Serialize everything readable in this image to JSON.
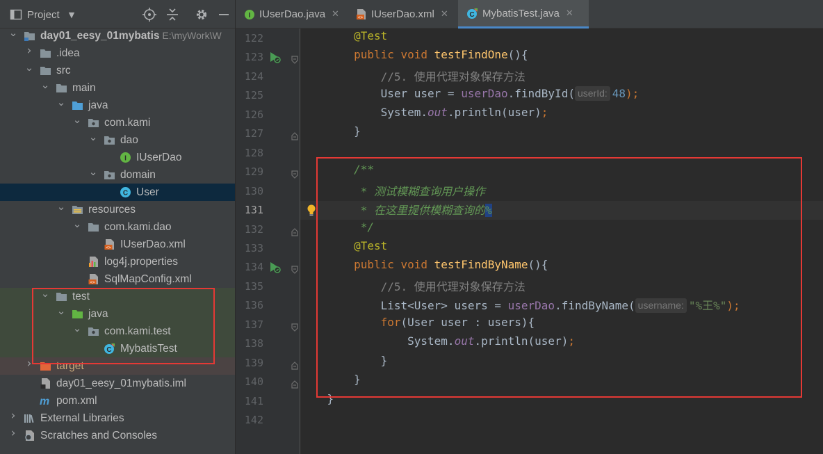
{
  "project_panel": {
    "title": "Project",
    "tree": [
      {
        "label": "day01_eesy_01mybatis",
        "path": "E:\\myWork\\W",
        "icon": "module-folder-icon",
        "depth": 0,
        "arrow": "down"
      },
      {
        "label": ".idea",
        "icon": "folder-icon",
        "depth": 1,
        "arrow": "right"
      },
      {
        "label": "src",
        "icon": "folder-icon",
        "depth": 1,
        "arrow": "down"
      },
      {
        "label": "main",
        "icon": "folder-icon",
        "depth": 2,
        "arrow": "down"
      },
      {
        "label": "java",
        "icon": "source-folder-icon",
        "depth": 3,
        "arrow": "down"
      },
      {
        "label": "com.kami",
        "icon": "package-icon",
        "depth": 4,
        "arrow": "down"
      },
      {
        "label": "dao",
        "icon": "package-icon",
        "depth": 5,
        "arrow": "down"
      },
      {
        "label": "IUserDao",
        "icon": "interface-icon",
        "depth": 6,
        "arrow": "none"
      },
      {
        "label": "domain",
        "icon": "package-icon",
        "depth": 5,
        "arrow": "down"
      },
      {
        "label": "User",
        "icon": "class-icon",
        "depth": 6,
        "arrow": "none",
        "selected": true
      },
      {
        "label": "resources",
        "icon": "resources-folder-icon",
        "depth": 3,
        "arrow": "down"
      },
      {
        "label": "com.kami.dao",
        "icon": "folder-icon",
        "depth": 4,
        "arrow": "down"
      },
      {
        "label": "IUserDao.xml",
        "icon": "xml-file-icon",
        "depth": 5,
        "arrow": "none"
      },
      {
        "label": "log4j.properties",
        "icon": "properties-file-icon",
        "depth": 4,
        "arrow": "none"
      },
      {
        "label": "SqlMapConfig.xml",
        "icon": "xml-file-icon",
        "depth": 4,
        "arrow": "none"
      },
      {
        "label": "test",
        "icon": "folder-icon",
        "depth": 2,
        "arrow": "down",
        "zone": "test"
      },
      {
        "label": "java",
        "icon": "test-source-folder-icon",
        "depth": 3,
        "arrow": "down",
        "zone": "test"
      },
      {
        "label": "com.kami.test",
        "icon": "package-icon",
        "depth": 4,
        "arrow": "down",
        "zone": "test"
      },
      {
        "label": "MybatisTest",
        "icon": "test-class-icon",
        "depth": 5,
        "arrow": "none",
        "zone": "test"
      },
      {
        "label": "target",
        "icon": "excluded-folder-icon",
        "depth": 1,
        "arrow": "right",
        "zone": "excluded"
      },
      {
        "label": "day01_eesy_01mybatis.iml",
        "icon": "iml-file-icon",
        "depth": 1,
        "arrow": "none"
      },
      {
        "label": "pom.xml",
        "icon": "maven-icon",
        "depth": 1,
        "arrow": "none"
      },
      {
        "label": "External Libraries",
        "icon": "libraries-icon",
        "depth": 0,
        "arrow": "right"
      },
      {
        "label": "Scratches and Consoles",
        "icon": "scratches-icon",
        "depth": 0,
        "arrow": "right"
      }
    ]
  },
  "tabs": [
    {
      "label": "IUserDao.java",
      "icon": "interface-icon",
      "active": false
    },
    {
      "label": "IUserDao.xml",
      "icon": "xml-file-icon",
      "active": false
    },
    {
      "label": "MybatisTest.java",
      "icon": "test-class-icon",
      "active": true
    }
  ],
  "editor": {
    "current_line": 131,
    "lines": [
      {
        "n": 122,
        "tokens": [
          [
            "    ",
            ""
          ],
          [
            "@Test",
            "ann"
          ]
        ]
      },
      {
        "n": 123,
        "run": true,
        "fold": "start",
        "tokens": [
          [
            "    ",
            ""
          ],
          [
            "public",
            "kw"
          ],
          [
            " ",
            ""
          ],
          [
            "void",
            "kw"
          ],
          [
            " ",
            ""
          ],
          [
            "testFindOne",
            "fn"
          ],
          [
            "(){",
            ""
          ]
        ]
      },
      {
        "n": 124,
        "tokens": [
          [
            "        ",
            ""
          ],
          [
            "//5. 使用代理对象保存方法",
            "cmt"
          ]
        ]
      },
      {
        "n": 125,
        "tokens": [
          [
            "        User user = ",
            ""
          ],
          [
            "userDao",
            "fld"
          ],
          [
            ".findById(",
            ""
          ],
          [
            "userId:",
            "hint"
          ],
          [
            "48",
            "num"
          ],
          [
            ");",
            "kw"
          ]
        ]
      },
      {
        "n": 126,
        "tokens": [
          [
            "        System.",
            ""
          ],
          [
            "out",
            "sfld"
          ],
          [
            ".println(user)",
            ""
          ],
          [
            ";",
            "kw"
          ]
        ]
      },
      {
        "n": 127,
        "fold": "end",
        "tokens": [
          [
            "    }",
            ""
          ]
        ]
      },
      {
        "n": 128,
        "tokens": []
      },
      {
        "n": 129,
        "fold": "start",
        "tokens": [
          [
            "    ",
            ""
          ],
          [
            "/**",
            "doc"
          ]
        ]
      },
      {
        "n": 130,
        "tokens": [
          [
            "     ",
            ""
          ],
          [
            "* 测试模糊查询用户操作",
            "doc"
          ]
        ]
      },
      {
        "n": 131,
        "bulb": true,
        "tokens": [
          [
            "     ",
            ""
          ],
          [
            "* 在这里提供模糊查询的",
            "doc"
          ],
          [
            "%",
            "sel"
          ]
        ]
      },
      {
        "n": 132,
        "fold": "end",
        "tokens": [
          [
            "     ",
            ""
          ],
          [
            "*/",
            "doc"
          ]
        ]
      },
      {
        "n": 133,
        "tokens": [
          [
            "    ",
            ""
          ],
          [
            "@Test",
            "ann"
          ]
        ]
      },
      {
        "n": 134,
        "run": true,
        "fold": "start",
        "tokens": [
          [
            "    ",
            ""
          ],
          [
            "public",
            "kw"
          ],
          [
            " ",
            ""
          ],
          [
            "void",
            "kw"
          ],
          [
            " ",
            ""
          ],
          [
            "testFindByName",
            "fn"
          ],
          [
            "(){",
            ""
          ]
        ]
      },
      {
        "n": 135,
        "tokens": [
          [
            "        ",
            ""
          ],
          [
            "//5. 使用代理对象保存方法",
            "cmt"
          ]
        ]
      },
      {
        "n": 136,
        "tokens": [
          [
            "        List<User> users = ",
            ""
          ],
          [
            "userDao",
            "fld"
          ],
          [
            ".findByName(",
            ""
          ],
          [
            "username:",
            "hint"
          ],
          [
            "\"%王%\"",
            "str"
          ],
          [
            ");",
            "kw"
          ]
        ]
      },
      {
        "n": 137,
        "fold": "start",
        "tokens": [
          [
            "        ",
            ""
          ],
          [
            "for",
            "kw"
          ],
          [
            "(User user : users){",
            ""
          ]
        ]
      },
      {
        "n": 138,
        "tokens": [
          [
            "            System.",
            ""
          ],
          [
            "out",
            "sfld"
          ],
          [
            ".println(user)",
            ""
          ],
          [
            ";",
            "kw"
          ]
        ]
      },
      {
        "n": 139,
        "fold": "end",
        "tokens": [
          [
            "        }",
            ""
          ]
        ]
      },
      {
        "n": 140,
        "fold": "end",
        "tokens": [
          [
            "    }",
            ""
          ]
        ]
      },
      {
        "n": 141,
        "tokens": [
          [
            "}",
            ""
          ]
        ]
      },
      {
        "n": 142,
        "tokens": []
      }
    ]
  },
  "colors": {
    "highlight_box": "#e53935",
    "selection": "#0d293e",
    "accent": "#4a88c7"
  }
}
